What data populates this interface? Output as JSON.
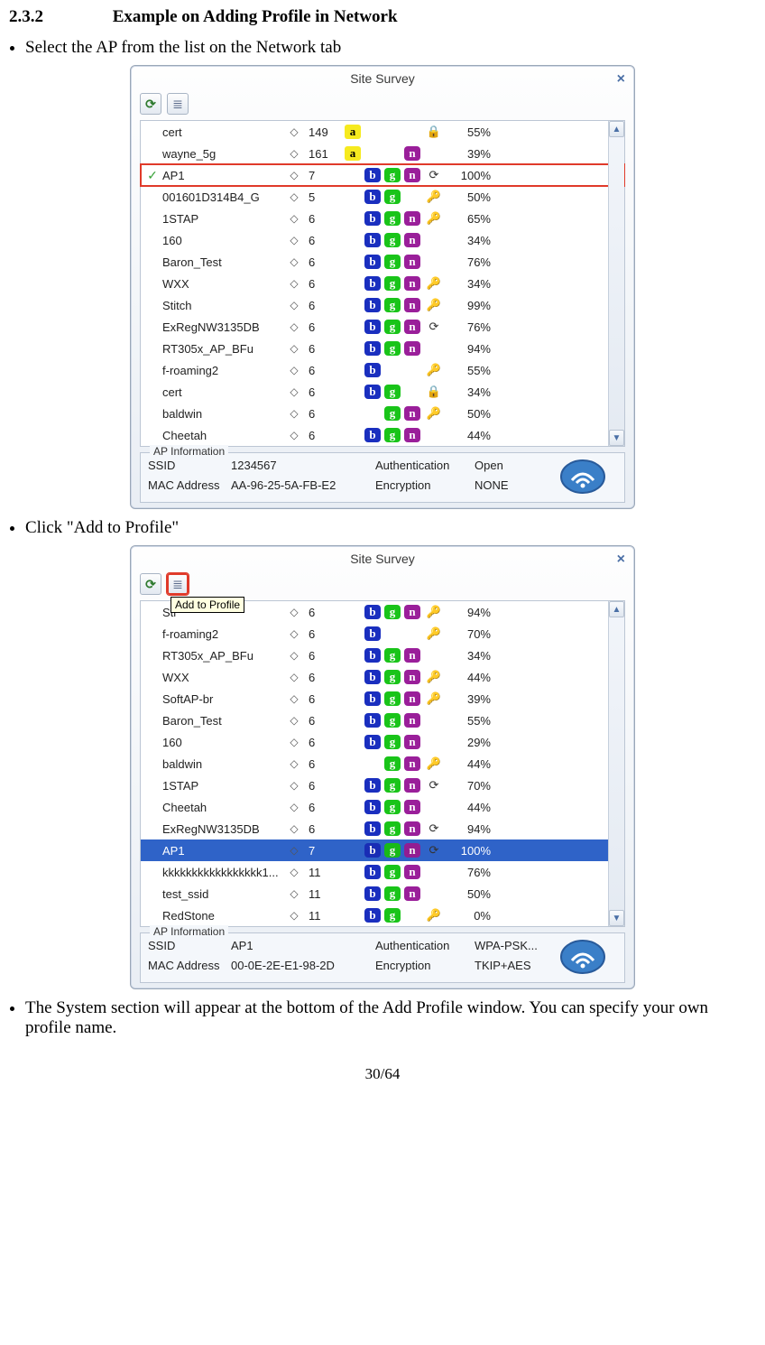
{
  "heading": {
    "number": "2.3.2",
    "title": "Example on Adding Profile in Network"
  },
  "bullets": {
    "b1": "Select the AP from the list on the Network tab",
    "b2": "Click \"Add to Profile\"",
    "b3": "The System section will appear at the bottom of the Add Profile window. You can specify your own profile name."
  },
  "page_number": "30/64",
  "survey1": {
    "title": "Site Survey",
    "rows": [
      {
        "chk": "",
        "ssid": "cert",
        "chan": "149",
        "a": true,
        "b": false,
        "g": false,
        "n": false,
        "sec": "lock",
        "sig": "55%"
      },
      {
        "chk": "",
        "ssid": "wayne_5g",
        "chan": "161",
        "a": true,
        "b": false,
        "g": false,
        "n": true,
        "sec": "",
        "sig": "39%"
      },
      {
        "chk": "✓",
        "ssid": "AP1",
        "chan": "7",
        "a": false,
        "b": true,
        "g": true,
        "n": true,
        "sec": "wps",
        "sig": "100%",
        "selected": "red"
      },
      {
        "chk": "",
        "ssid": "001601D314B4_G",
        "chan": "5",
        "a": false,
        "b": true,
        "g": true,
        "n": false,
        "sec": "key",
        "sig": "50%"
      },
      {
        "chk": "",
        "ssid": "1STAP",
        "chan": "6",
        "a": false,
        "b": true,
        "g": true,
        "n": true,
        "sec": "key",
        "sig": "65%"
      },
      {
        "chk": "",
        "ssid": "160",
        "chan": "6",
        "a": false,
        "b": true,
        "g": true,
        "n": true,
        "sec": "",
        "sig": "34%"
      },
      {
        "chk": "",
        "ssid": "Baron_Test",
        "chan": "6",
        "a": false,
        "b": true,
        "g": true,
        "n": true,
        "sec": "",
        "sig": "76%"
      },
      {
        "chk": "",
        "ssid": "WXX",
        "chan": "6",
        "a": false,
        "b": true,
        "g": true,
        "n": true,
        "sec": "key",
        "sig": "34%"
      },
      {
        "chk": "",
        "ssid": "Stitch",
        "chan": "6",
        "a": false,
        "b": true,
        "g": true,
        "n": true,
        "sec": "key",
        "sig": "99%"
      },
      {
        "chk": "",
        "ssid": "ExRegNW3135DB",
        "chan": "6",
        "a": false,
        "b": true,
        "g": true,
        "n": true,
        "sec": "wps",
        "sig": "76%"
      },
      {
        "chk": "",
        "ssid": "RT305x_AP_BFu",
        "chan": "6",
        "a": false,
        "b": true,
        "g": true,
        "n": true,
        "sec": "",
        "sig": "94%"
      },
      {
        "chk": "",
        "ssid": "f-roaming2",
        "chan": "6",
        "a": false,
        "b": true,
        "g": false,
        "n": false,
        "sec": "key",
        "sig": "55%"
      },
      {
        "chk": "",
        "ssid": "cert",
        "chan": "6",
        "a": false,
        "b": true,
        "g": true,
        "n": false,
        "sec": "lock",
        "sig": "34%"
      },
      {
        "chk": "",
        "ssid": "baldwin",
        "chan": "6",
        "a": false,
        "b": false,
        "g": true,
        "n": true,
        "sec": "key",
        "sig": "50%"
      },
      {
        "chk": "",
        "ssid": "Cheetah",
        "chan": "6",
        "a": false,
        "b": true,
        "g": true,
        "n": true,
        "sec": "",
        "sig": "44%"
      }
    ],
    "info": {
      "legend": "AP Information",
      "ssid_label": "SSID",
      "ssid_value": "1234567",
      "mac_label": "MAC Address",
      "mac_value": "AA-96-25-5A-FB-E2",
      "auth_label": "Authentication",
      "auth_value": "Open",
      "enc_label": "Encryption",
      "enc_value": "NONE"
    }
  },
  "survey2": {
    "title": "Site Survey",
    "tooltip": "Add to Profile",
    "rows": [
      {
        "chk": "",
        "ssid": "Sti",
        "chan": "6",
        "a": false,
        "b": true,
        "g": true,
        "n": true,
        "sec": "key",
        "sig": "94%"
      },
      {
        "chk": "",
        "ssid": "f-roaming2",
        "chan": "6",
        "a": false,
        "b": true,
        "g": false,
        "n": false,
        "sec": "key",
        "sig": "70%"
      },
      {
        "chk": "",
        "ssid": "RT305x_AP_BFu",
        "chan": "6",
        "a": false,
        "b": true,
        "g": true,
        "n": true,
        "sec": "",
        "sig": "34%"
      },
      {
        "chk": "",
        "ssid": "WXX",
        "chan": "6",
        "a": false,
        "b": true,
        "g": true,
        "n": true,
        "sec": "key",
        "sig": "44%"
      },
      {
        "chk": "",
        "ssid": "SoftAP-br",
        "chan": "6",
        "a": false,
        "b": true,
        "g": true,
        "n": true,
        "sec": "key",
        "sig": "39%"
      },
      {
        "chk": "",
        "ssid": "Baron_Test",
        "chan": "6",
        "a": false,
        "b": true,
        "g": true,
        "n": true,
        "sec": "",
        "sig": "55%"
      },
      {
        "chk": "",
        "ssid": "160",
        "chan": "6",
        "a": false,
        "b": true,
        "g": true,
        "n": true,
        "sec": "",
        "sig": "29%"
      },
      {
        "chk": "",
        "ssid": "baldwin",
        "chan": "6",
        "a": false,
        "b": false,
        "g": true,
        "n": true,
        "sec": "key",
        "sig": "44%"
      },
      {
        "chk": "",
        "ssid": "1STAP",
        "chan": "6",
        "a": false,
        "b": true,
        "g": true,
        "n": true,
        "sec": "wps",
        "sig": "70%"
      },
      {
        "chk": "",
        "ssid": "Cheetah",
        "chan": "6",
        "a": false,
        "b": true,
        "g": true,
        "n": true,
        "sec": "",
        "sig": "44%"
      },
      {
        "chk": "",
        "ssid": "ExRegNW3135DB",
        "chan": "6",
        "a": false,
        "b": true,
        "g": true,
        "n": true,
        "sec": "wps",
        "sig": "94%"
      },
      {
        "chk": "",
        "ssid": "AP1",
        "chan": "7",
        "a": false,
        "b": true,
        "g": true,
        "n": true,
        "sec": "wps",
        "sig": "100%",
        "selected": "blue"
      },
      {
        "chk": "",
        "ssid": "kkkkkkkkkkkkkkkkk1...",
        "chan": "11",
        "a": false,
        "b": true,
        "g": true,
        "n": true,
        "sec": "",
        "sig": "76%"
      },
      {
        "chk": "",
        "ssid": "test_ssid",
        "chan": "11",
        "a": false,
        "b": true,
        "g": true,
        "n": true,
        "sec": "",
        "sig": "50%"
      },
      {
        "chk": "",
        "ssid": "RedStone",
        "chan": "11",
        "a": false,
        "b": true,
        "g": true,
        "n": false,
        "sec": "key",
        "sig": "0%"
      }
    ],
    "info": {
      "legend": "AP Information",
      "ssid_label": "SSID",
      "ssid_value": "AP1",
      "mac_label": "MAC Address",
      "mac_value": "00-0E-2E-E1-98-2D",
      "auth_label": "Authentication",
      "auth_value": "WPA-PSK...",
      "enc_label": "Encryption",
      "enc_value": "TKIP+AES"
    }
  }
}
